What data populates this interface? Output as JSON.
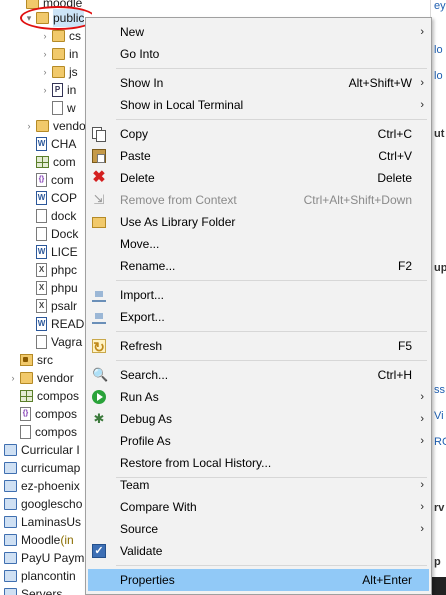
{
  "tree": {
    "items": [
      {
        "label": "moodle",
        "icon": "folder-icon"
      },
      {
        "label": "public",
        "icon": "folder-icon"
      },
      {
        "label": "cs",
        "icon": "folder-icon"
      },
      {
        "label": "in",
        "icon": "folder-icon"
      },
      {
        "label": "js",
        "icon": "folder-icon"
      },
      {
        "label": "in",
        "icon": "php-file-icon",
        "glyph": "P"
      },
      {
        "label": "w",
        "icon": "file-icon"
      },
      {
        "label": "vendo",
        "icon": "folder-icon"
      },
      {
        "label": "CHA",
        "icon": "word-doc-icon",
        "glyph": "W"
      },
      {
        "label": "com",
        "icon": "grid-file-icon"
      },
      {
        "label": "com",
        "icon": "json-file-icon",
        "glyph": "{}"
      },
      {
        "label": "COP",
        "icon": "word-doc-icon",
        "glyph": "W"
      },
      {
        "label": "dock",
        "icon": "file-icon"
      },
      {
        "label": "Dock",
        "icon": "file-icon"
      },
      {
        "label": "LICE",
        "icon": "word-doc-icon",
        "glyph": "W"
      },
      {
        "label": "phpc",
        "icon": "xml-file-icon",
        "glyph": "X"
      },
      {
        "label": "phpu",
        "icon": "xml-file-icon",
        "glyph": "X"
      },
      {
        "label": "psalr",
        "icon": "xml-file-icon",
        "glyph": "X"
      },
      {
        "label": "READ",
        "icon": "word-doc-icon",
        "glyph": "W"
      },
      {
        "label": "Vagra",
        "icon": "file-icon"
      },
      {
        "label": "src",
        "icon": "source-folder-icon"
      },
      {
        "label": "vendor",
        "icon": "folder-icon"
      },
      {
        "label": "compos",
        "icon": "grid-file-icon"
      },
      {
        "label": "compos",
        "icon": "json-file-icon",
        "glyph": "{}"
      },
      {
        "label": "compos",
        "icon": "file-icon"
      },
      {
        "label": "Curricular I",
        "icon": "project-icon"
      },
      {
        "label": "curricumap",
        "icon": "project-icon"
      },
      {
        "label": "ez-phoenix",
        "icon": "project-icon"
      },
      {
        "label": "googlescho",
        "icon": "project-icon"
      },
      {
        "label": "LaminasUs",
        "icon": "project-icon"
      },
      {
        "label": "Moodle",
        "icon": "project-icon",
        "deco": " (in"
      },
      {
        "label": "PayU Paym",
        "icon": "project-icon"
      },
      {
        "label": "plancontin",
        "icon": "project-icon"
      },
      {
        "label": "Servers",
        "icon": "project-icon"
      }
    ]
  },
  "side_panel": {
    "fragments": [
      "ey",
      "lo",
      "lo",
      "ut",
      "up",
      "ss",
      "Vi",
      "RC",
      "rv",
      "p"
    ]
  },
  "menu": {
    "items": [
      {
        "label": "New",
        "submenu": true
      },
      {
        "label": "Go Into"
      },
      {
        "label": "Show In",
        "shortcut": "Alt+Shift+W",
        "submenu": true
      },
      {
        "label": "Show in Local Terminal",
        "submenu": true
      },
      {
        "label": "Copy",
        "shortcut": "Ctrl+C",
        "icon": "copy-icon"
      },
      {
        "label": "Paste",
        "shortcut": "Ctrl+V",
        "icon": "paste-icon"
      },
      {
        "label": "Delete",
        "shortcut": "Delete",
        "icon": "delete-icon",
        "glyph": "✖"
      },
      {
        "label": "Remove from Context",
        "shortcut": "Ctrl+Alt+Shift+Down",
        "disabled": true,
        "icon": "remove-context-icon",
        "glyph": "⇲"
      },
      {
        "label": "Use As Library Folder",
        "icon": "library-folder-icon"
      },
      {
        "label": "Move..."
      },
      {
        "label": "Rename...",
        "shortcut": "F2"
      },
      {
        "label": "Import...",
        "icon": "import-icon"
      },
      {
        "label": "Export...",
        "icon": "export-icon"
      },
      {
        "label": "Refresh",
        "shortcut": "F5",
        "icon": "refresh-icon",
        "glyph": "↻"
      },
      {
        "label": "Search...",
        "shortcut": "Ctrl+H",
        "icon": "search-icon",
        "glyph": "🔍"
      },
      {
        "label": "Run As",
        "submenu": true,
        "icon": "run-icon"
      },
      {
        "label": "Debug As",
        "submenu": true,
        "icon": "debug-icon",
        "glyph": "✱"
      },
      {
        "label": "Profile As",
        "submenu": true
      },
      {
        "label": "Restore from Local History..."
      },
      {
        "label": "Team",
        "submenu": true
      },
      {
        "label": "Compare With",
        "submenu": true
      },
      {
        "label": "Source",
        "submenu": true
      },
      {
        "label": "Validate",
        "icon": "validate-icon",
        "glyph": "✓"
      },
      {
        "label": "Properties",
        "shortcut": "Alt+Enter",
        "highlighted": true
      }
    ],
    "arrow_glyph": "›"
  },
  "colors": {
    "menu_background": "#f2f2f2",
    "highlight": "#91c9f7",
    "selection_ring": "#e01010",
    "disabled_text": "#8a8a8a"
  }
}
